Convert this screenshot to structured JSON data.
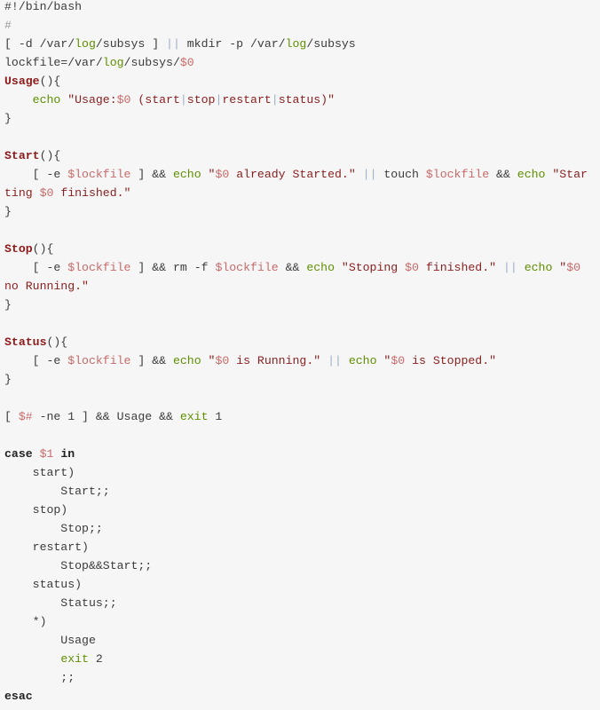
{
  "language": "bash",
  "colors": {
    "background": "#f6f6f6",
    "text": "#3b3b3b",
    "function": "#8b1a1a",
    "builtin": "#5f8f00",
    "string": "#8b2020",
    "variable": "#c96a6a",
    "operator": "#9fb0c4",
    "comment": "#999999"
  },
  "lines": [
    [
      [
        "p",
        "#!/bin/bash"
      ]
    ],
    [
      [
        "c",
        "#"
      ]
    ],
    [
      [
        "p",
        "[ -d /var/"
      ],
      [
        "b",
        "log"
      ],
      [
        "p",
        "/subsys ] "
      ],
      [
        "o",
        "||"
      ],
      [
        "p",
        " mkdir -p /var/"
      ],
      [
        "b",
        "log"
      ],
      [
        "p",
        "/subsys"
      ]
    ],
    [
      [
        "p",
        "lockfile=/var/"
      ],
      [
        "b",
        "log"
      ],
      [
        "p",
        "/subsys/"
      ],
      [
        "v",
        "$0"
      ]
    ],
    [
      [
        "f",
        "Usage"
      ],
      [
        "p",
        "(){"
      ]
    ],
    [
      [
        "p",
        "    "
      ],
      [
        "b",
        "echo"
      ],
      [
        "p",
        " "
      ],
      [
        "s",
        "\"Usage:"
      ],
      [
        "v",
        "$0"
      ],
      [
        "s",
        " (start"
      ],
      [
        "o",
        "|"
      ],
      [
        "s",
        "stop"
      ],
      [
        "o",
        "|"
      ],
      [
        "s",
        "restart"
      ],
      [
        "o",
        "|"
      ],
      [
        "s",
        "status)\""
      ]
    ],
    [
      [
        "p",
        "}"
      ]
    ],
    [],
    [
      [
        "f",
        "Start"
      ],
      [
        "p",
        "(){"
      ]
    ],
    [
      [
        "p",
        "    [ -e "
      ],
      [
        "v",
        "$lockfile"
      ],
      [
        "p",
        " ] && "
      ],
      [
        "b",
        "echo"
      ],
      [
        "p",
        " "
      ],
      [
        "s",
        "\""
      ],
      [
        "v",
        "$0"
      ],
      [
        "s",
        " already Started.\""
      ],
      [
        "p",
        " "
      ],
      [
        "o",
        "||"
      ],
      [
        "p",
        " touch "
      ],
      [
        "v",
        "$lockfile"
      ],
      [
        "p",
        " && "
      ],
      [
        "b",
        "echo"
      ],
      [
        "p",
        " "
      ],
      [
        "s",
        "\"Star"
      ]
    ],
    [
      [
        "s",
        "ting "
      ],
      [
        "v",
        "$0"
      ],
      [
        "s",
        " finished.\""
      ]
    ],
    [
      [
        "p",
        "}"
      ]
    ],
    [],
    [
      [
        "f",
        "Stop"
      ],
      [
        "p",
        "(){"
      ]
    ],
    [
      [
        "p",
        "    [ -e "
      ],
      [
        "v",
        "$lockfile"
      ],
      [
        "p",
        " ] && rm -f "
      ],
      [
        "v",
        "$lockfile"
      ],
      [
        "p",
        " && "
      ],
      [
        "b",
        "echo"
      ],
      [
        "p",
        " "
      ],
      [
        "s",
        "\"Stoping "
      ],
      [
        "v",
        "$0"
      ],
      [
        "s",
        " finished.\""
      ],
      [
        "p",
        " "
      ],
      [
        "o",
        "||"
      ],
      [
        "p",
        " "
      ],
      [
        "b",
        "echo"
      ],
      [
        "p",
        " "
      ],
      [
        "s",
        "\""
      ],
      [
        "v",
        "$0"
      ]
    ],
    [
      [
        "s",
        "no Running.\""
      ]
    ],
    [
      [
        "p",
        "}"
      ]
    ],
    [],
    [
      [
        "f",
        "Status"
      ],
      [
        "p",
        "(){"
      ]
    ],
    [
      [
        "p",
        "    [ -e "
      ],
      [
        "v",
        "$lockfile"
      ],
      [
        "p",
        " ] && "
      ],
      [
        "b",
        "echo"
      ],
      [
        "p",
        " "
      ],
      [
        "s",
        "\""
      ],
      [
        "v",
        "$0"
      ],
      [
        "s",
        " is Running.\""
      ],
      [
        "p",
        " "
      ],
      [
        "o",
        "||"
      ],
      [
        "p",
        " "
      ],
      [
        "b",
        "echo"
      ],
      [
        "p",
        " "
      ],
      [
        "s",
        "\""
      ],
      [
        "v",
        "$0"
      ],
      [
        "s",
        " is Stopped.\""
      ]
    ],
    [
      [
        "p",
        "}"
      ]
    ],
    [],
    [
      [
        "p",
        "[ "
      ],
      [
        "v",
        "$#"
      ],
      [
        "p",
        " -ne 1 ] && Usage && "
      ],
      [
        "b",
        "exit"
      ],
      [
        "p",
        " 1"
      ]
    ],
    [],
    [
      [
        "k",
        "case"
      ],
      [
        "p",
        " "
      ],
      [
        "v",
        "$1"
      ],
      [
        "p",
        " "
      ],
      [
        "k",
        "in"
      ]
    ],
    [
      [
        "p",
        "    start)"
      ]
    ],
    [
      [
        "p",
        "        Start;;"
      ]
    ],
    [
      [
        "p",
        "    stop)"
      ]
    ],
    [
      [
        "p",
        "        Stop;;"
      ]
    ],
    [
      [
        "p",
        "    restart)"
      ]
    ],
    [
      [
        "p",
        "        Stop&&Start;;"
      ]
    ],
    [
      [
        "p",
        "    status)"
      ]
    ],
    [
      [
        "p",
        "        Status;;"
      ]
    ],
    [
      [
        "p",
        "    *)"
      ]
    ],
    [
      [
        "p",
        "        Usage"
      ]
    ],
    [
      [
        "p",
        "        "
      ],
      [
        "b",
        "exit"
      ],
      [
        "p",
        " 2"
      ]
    ],
    [
      [
        "p",
        "        ;;"
      ]
    ],
    [
      [
        "k",
        "esac"
      ]
    ]
  ]
}
